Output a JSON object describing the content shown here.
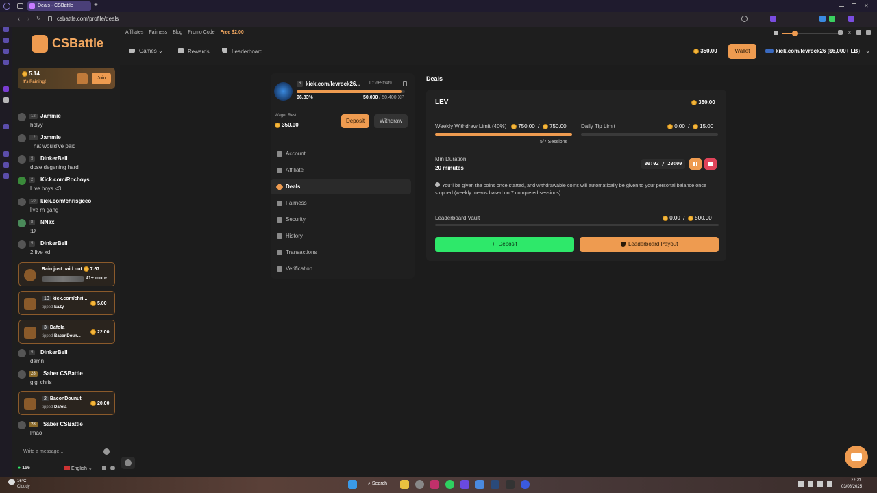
{
  "browser": {
    "tab_title": "Deals - CSBattle",
    "url": "csbattle.com/profile/deals",
    "new_tab_symbol": "+"
  },
  "site": {
    "logo_text": "CSBattle",
    "top_links": [
      "Affiliates",
      "Fairness",
      "Blog",
      "Promo Code"
    ],
    "free_link": "Free $2.00",
    "nav": {
      "games": "Games",
      "rewards": "Rewards",
      "leaderboard": "Leaderboard"
    },
    "balance": "350.00",
    "wallet_label": "Wallet",
    "user_label": "kick.com/levrock26 ($6,000+ LB)"
  },
  "chat": {
    "rain_amount": "5.14",
    "rain_text": "It's Raining!",
    "join_label": "Join",
    "messages": [
      {
        "level": "12",
        "name": "Jammie",
        "text": "holyy"
      },
      {
        "level": "12",
        "name": "Jammie",
        "text": "That would've paid"
      },
      {
        "level": "5",
        "name": "DinkerBell",
        "text": "dose degening hard"
      },
      {
        "level": "2",
        "name": "Kick.com/Rocboys",
        "text": "Live boys <3"
      },
      {
        "level": "10",
        "name": "kick.com/chrisgceo",
        "text": "live rn gang"
      },
      {
        "level": "8",
        "name": "NNax",
        "text": ":D"
      },
      {
        "level": "5",
        "name": "DinkerBell",
        "text": "2 live xd"
      }
    ],
    "rain_paid": {
      "text": "Rain just paid out",
      "amount": "7.67",
      "more": "41+ more"
    },
    "tips": [
      {
        "level": "10",
        "name": "kick.com/chri...",
        "action": "tipped",
        "target": "EaZy",
        "amount": "5.00"
      },
      {
        "level": "3",
        "name": "Dafola",
        "action": "tipped",
        "target": "BaconDoun...",
        "amount": "22.00"
      },
      {
        "level": "2",
        "name": "BaconDounut",
        "action": "tipped",
        "target": "Dafola",
        "amount": "20.00"
      }
    ],
    "messages2": [
      {
        "level": "5",
        "name": "DinkerBell",
        "text": "damn"
      },
      {
        "level": "28",
        "name": "Saber CSBattle",
        "text": "gigi chris"
      },
      {
        "level": "28",
        "name": "Saber CSBattle",
        "text": "lmao"
      }
    ],
    "input_placeholder": "Write a message...",
    "online_count": "156",
    "language": "English"
  },
  "profile": {
    "level": "6",
    "username": "kick.com/levrock26...",
    "id_label": "ID: d65fbaf9...",
    "xp_percent_label": "96.83%",
    "xp_current": "50,000",
    "xp_sep": "/",
    "xp_total": "50,400 XP",
    "xp_fraction": 0.9683,
    "wager_label": "Wager Rest",
    "wager_value": "350.00",
    "deposit_label": "Deposit",
    "withdraw_label": "Withdraw",
    "menu": [
      "Account",
      "Affiliate",
      "Deals",
      "Fairness",
      "Security",
      "History",
      "Transactions",
      "Verification"
    ],
    "active_menu": "Deals"
  },
  "deals": {
    "title": "Deals",
    "deal_name": "LEV",
    "deal_amount": "350.00",
    "weekly_label": "Weekly Withdraw Limit (40%)",
    "weekly_current": "750.00",
    "weekly_max": "750.00",
    "weekly_fraction": 1.0,
    "sessions": "5/7 Sessions",
    "daily_label": "Daily Tip Limit",
    "daily_current": "0.00",
    "daily_max": "15.00",
    "daily_fraction": 0.0,
    "min_duration_label": "Min Duration",
    "min_duration_value": "20 minutes",
    "timer_elapsed": "00:02",
    "timer_total": "20:00",
    "info_text": "You'll be given the coins once started, and withdrawable coins will automatically be given to your personal balance once stopped (weekly means based on 7 completed sessions)",
    "vault_label": "Leaderboard Vault",
    "vault_current": "0.00",
    "vault_max": "500.00",
    "vault_fraction": 0.0,
    "deposit_button": "Deposit",
    "payout_button": "Leaderboard Payout"
  },
  "taskbar": {
    "weather_temp": "16°C",
    "weather_desc": "Cloudy",
    "search_label": "Search",
    "time": "22:27",
    "date": "03/08/2025"
  },
  "colors": {
    "accent": "#ee9b50",
    "green": "#2ee86a",
    "red": "#e0445a"
  }
}
